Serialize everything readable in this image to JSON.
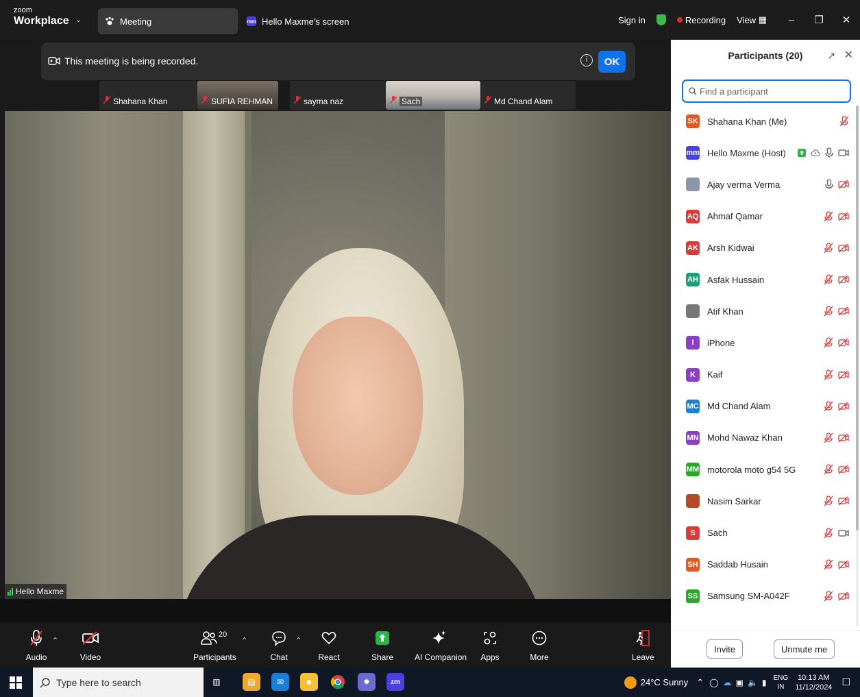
{
  "titlebar": {
    "brand_small": "zoom",
    "brand_main": "Workplace",
    "tab_meeting": "Meeting",
    "tab_screen": "Hello Maxme's screen",
    "tab_screen_badge": "mm",
    "sign_in": "Sign in",
    "recording": "Recording",
    "view": "View"
  },
  "notice": {
    "text": "This meeting is being recorded.",
    "ok": "OK",
    "info": "i"
  },
  "thumbnails": [
    {
      "name": "Shahana Khan"
    },
    {
      "name": "SUFIA REHMAN"
    },
    {
      "name": "sayma naz"
    },
    {
      "name": "Sach"
    },
    {
      "name": "Md Chand Alam"
    }
  ],
  "speaker": {
    "name": "Hello Maxme"
  },
  "toolbar": {
    "audio": "Audio",
    "video": "Video",
    "participants": "Participants",
    "participants_count": "20",
    "chat": "Chat",
    "react": "React",
    "share": "Share",
    "ai": "AI Companion",
    "apps": "Apps",
    "more": "More",
    "leave": "Leave"
  },
  "panel": {
    "title": "Participants (20)",
    "search_placeholder": "Find a participant",
    "invite": "Invite",
    "unmute": "Unmute me",
    "participants": [
      {
        "initials": "SK",
        "name": "Shahana Khan (Me)",
        "color": "#e2581e",
        "icons": "mic-off"
      },
      {
        "initials": "mm",
        "name": "Hello Maxme (Host)",
        "color": "#4a3fe0",
        "icons": "host"
      },
      {
        "initials": "",
        "name": "Ajay verma Verma",
        "color": "#8a97a8",
        "icons": "mic-cam-off"
      },
      {
        "initials": "AQ",
        "name": "Ahmaf Qamar",
        "color": "#d93a3a",
        "icons": "both-off"
      },
      {
        "initials": "AK",
        "name": "Arsh Kidwai",
        "color": "#d93a3a",
        "icons": "both-off"
      },
      {
        "initials": "AH",
        "name": "Asfak Hussain",
        "color": "#18a07a",
        "icons": "both-off"
      },
      {
        "initials": "",
        "name": "Atif Khan",
        "color": "#777777",
        "icons": "both-off"
      },
      {
        "initials": "I",
        "name": "iPhone",
        "color": "#8a3fc4",
        "icons": "both-off"
      },
      {
        "initials": "K",
        "name": "Kaif",
        "color": "#8a3fc4",
        "icons": "both-off"
      },
      {
        "initials": "MC",
        "name": "Md Chand Alam",
        "color": "#1f7fd0",
        "icons": "both-off"
      },
      {
        "initials": "MN",
        "name": "Mohd Nawaz Khan",
        "color": "#8a3fc4",
        "icons": "both-off"
      },
      {
        "initials": "MM",
        "name": "motorola moto g54 5G",
        "color": "#2aa82a",
        "icons": "both-off"
      },
      {
        "initials": "",
        "name": "Nasim Sarkar",
        "color": "#b04a2a",
        "icons": "both-off"
      },
      {
        "initials": "S",
        "name": "Sach",
        "color": "#d93a3a",
        "icons": "mic-off-cam-on"
      },
      {
        "initials": "SH",
        "name": "Saddab Husain",
        "color": "#e2581e",
        "icons": "both-off"
      },
      {
        "initials": "SS",
        "name": "Samsung SM-A042F",
        "color": "#2aa82a",
        "icons": "both-off"
      }
    ]
  },
  "taskbar": {
    "search_placeholder": "Type here to search",
    "weather": "24°C Sunny",
    "lang_top": "ENG",
    "lang_bottom": "IN",
    "time": "10:13 AM",
    "date": "11/12/2024",
    "zm": "zm"
  }
}
